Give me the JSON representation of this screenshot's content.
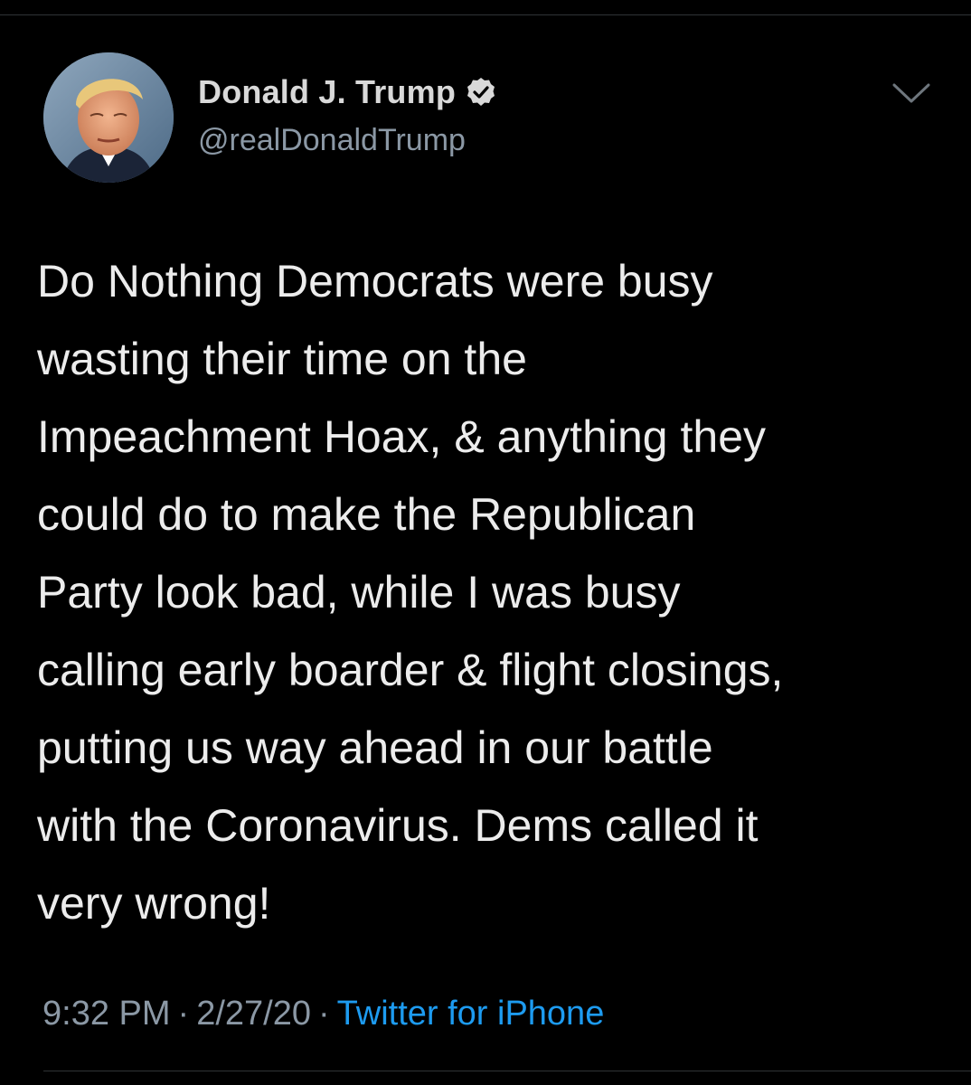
{
  "author": {
    "display_name": "Donald J. Trump",
    "handle": "@realDonaldTrump",
    "verified": true,
    "avatar": "profile-photo"
  },
  "icons": {
    "verified": "verified-badge-icon",
    "menu": "chevron-down-icon"
  },
  "tweet": {
    "text": "Do Nothing Democrats were busy\nwasting their time on the\nImpeachment Hoax, & anything they\ncould do to make the Republican\nParty look bad, while I was busy\ncalling early boarder & flight closings,\nputting us way ahead in our battle\nwith the Coronavirus. Dems called it\nvery wrong!",
    "time": "9:32 PM",
    "separator": "·",
    "date": "2/27/20",
    "source": "Twitter for iPhone"
  },
  "colors": {
    "background": "#000000",
    "text": "#ececec",
    "secondary": "#8b98a5",
    "link": "#1d9bf0"
  }
}
